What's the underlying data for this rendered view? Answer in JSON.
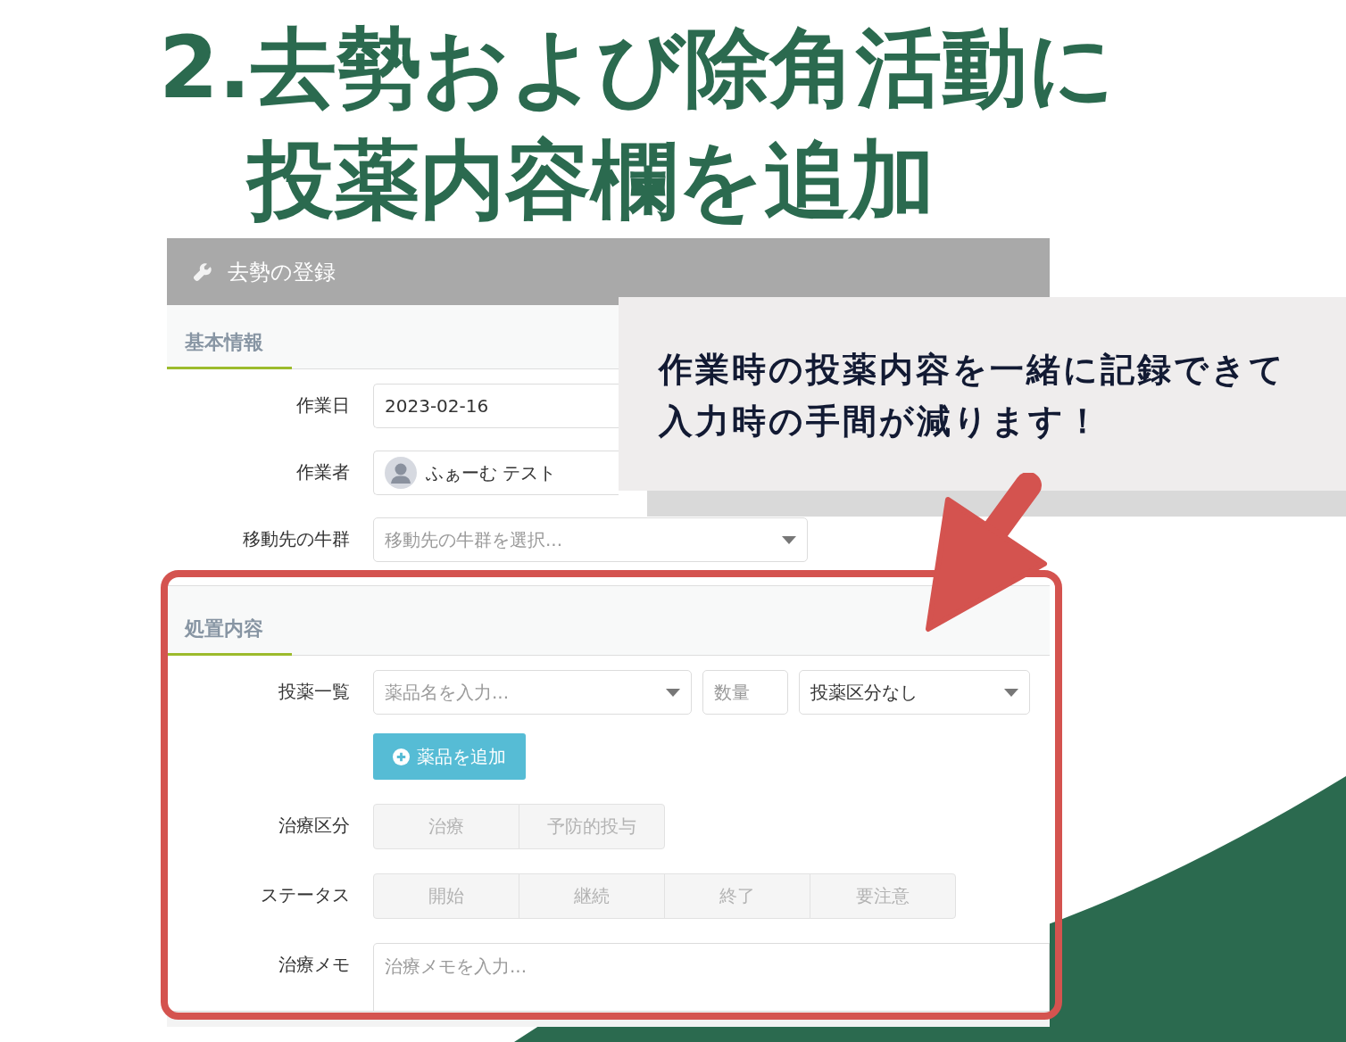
{
  "headline": {
    "lines": [
      "2.去勢および除角活動に",
      "投薬内容欄を追加"
    ]
  },
  "form": {
    "title": "去勢の登録",
    "sections": [
      {
        "title": "基本情報",
        "highlighted": false,
        "fields": [
          {
            "kind": "text",
            "label": "作業日",
            "value": "2023-02-16"
          },
          {
            "kind": "user",
            "label": "作業者",
            "value": "ふぁーむ テスト"
          },
          {
            "kind": "select",
            "label": "移動先の牛群",
            "placeholder": "移動先の牛群を選択..."
          }
        ]
      },
      {
        "title": "処置内容",
        "highlighted": true,
        "fields": [
          {
            "kind": "medication",
            "label": "投薬一覧",
            "drug": {
              "placeholder": "薬品名を入力..."
            },
            "quantity": {
              "placeholder": "数量"
            },
            "category": {
              "value": "投薬区分なし"
            },
            "add_button": "薬品を追加"
          },
          {
            "kind": "toggle",
            "label": "治療区分",
            "options": [
              {
                "label": "治療",
                "selected": false
              },
              {
                "label": "予防的投与",
                "selected": false
              }
            ]
          },
          {
            "kind": "toggle",
            "label": "ステータス",
            "options": [
              {
                "label": "開始",
                "selected": false
              },
              {
                "label": "継続",
                "selected": false
              },
              {
                "label": "終了",
                "selected": false
              },
              {
                "label": "要注意",
                "selected": false
              }
            ]
          },
          {
            "kind": "textarea",
            "label": "治療メモ",
            "placeholder": "治療メモを入力..."
          }
        ]
      }
    ]
  },
  "callout": {
    "lines": [
      "作業時の投薬内容を一緒に記録できて",
      "入力時の手間が減ります！"
    ]
  }
}
